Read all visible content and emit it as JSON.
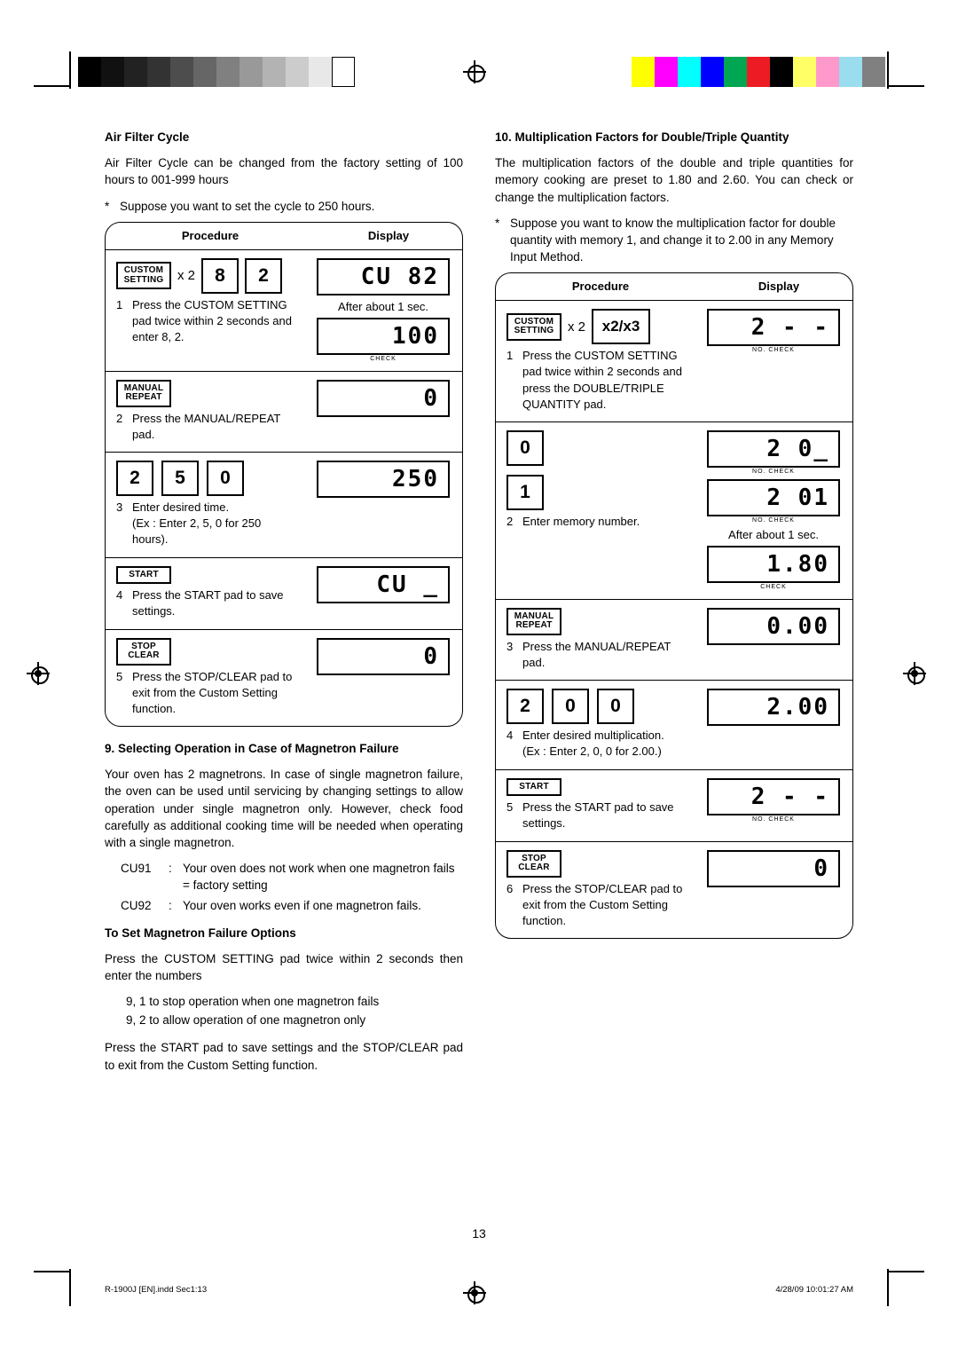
{
  "page": {
    "number": "13",
    "footer_left": "R-1900J [EN].indd   Sec1:13",
    "footer_right": "4/28/09   10:01:27 AM"
  },
  "left_column": {
    "air_filter": {
      "heading": "Air Filter Cycle",
      "intro": "Air Filter Cycle can be changed from the factory setting of 100 hours to 001-999 hours",
      "star": "Suppose you want to set the cycle to 250 hours.",
      "table": {
        "header_procedure": "Procedure",
        "header_display": "Display",
        "rows": [
          {
            "keys": {
              "pad_line1": "CUSTOM",
              "pad_line2": "SETTING",
              "multiplier": "x 2",
              "num1": "8",
              "num2": "2"
            },
            "step_no": "1",
            "step_text": "Press the CUSTOM SETTING pad twice within 2 seconds and enter 8, 2.",
            "display1": "CU 82",
            "display_note": "After about 1 sec.",
            "display2": "100",
            "display2_label": "CHECK"
          },
          {
            "keys": {
              "pad_line1": "MANUAL",
              "pad_line2": "REPEAT"
            },
            "step_no": "2",
            "step_text": "Press the MANUAL/REPEAT pad.",
            "display1": "0"
          },
          {
            "keys": {
              "num1": "2",
              "num2": "5",
              "num3": "0"
            },
            "step_no": "3",
            "step_text": "Enter desired time.",
            "step_sub": "(Ex : Enter 2, 5, 0 for 250 hours).",
            "display1": "250"
          },
          {
            "keys": {
              "pad_line1": "START"
            },
            "step_no": "4",
            "step_text": "Press the START pad to save settings.",
            "display1": "CU _"
          },
          {
            "keys": {
              "pad_line1": "STOP",
              "pad_line2": "CLEAR"
            },
            "step_no": "5",
            "step_text": "Press the STOP/CLEAR pad to exit from the Custom Setting function.",
            "display1": "0"
          }
        ]
      }
    },
    "magnetron": {
      "heading": "9.  Selecting Operation in Case of Magnetron Failure",
      "paragraph": "Your oven has 2 magnetrons. In case of single magnetron failure, the oven can be used until servicing by changing settings to allow operation under single magnetron only. However, check food carefully as additional cooking time will be needed when operating with a single magnetron.",
      "codes": [
        {
          "code": "CU91",
          "sep": ":",
          "text": "Your oven does not work when one magnetron fails =  factory setting"
        },
        {
          "code": "CU92",
          "sep": ":",
          "text": "Your oven works even if one magnetron  fails."
        }
      ],
      "sub_heading": "To Set Magnetron Failure Options",
      "sub_paragraph": "Press the CUSTOM SETTING pad twice within 2 seconds then enter the numbers",
      "options": [
        "9, 1 to stop operation when one magnetron fails",
        "9, 2 to allow operation of one magnetron only"
      ],
      "closing": "Press the START pad to save settings and the STOP/CLEAR pad to exit from the Custom Setting function."
    }
  },
  "right_column": {
    "heading": "10.  Multiplication Factors for Double/Triple Quantity",
    "intro": "The multiplication factors of the double and triple quantities for memory cooking are preset to 1.80 and 2.60. You can check or change the multiplication factors.",
    "star": "Suppose you want to know the multiplication factor for double quantity with memory 1, and change it to 2.00 in any Memory Input Method.",
    "table": {
      "header_procedure": "Procedure",
      "header_display": "Display",
      "rows": [
        {
          "keys": {
            "pad_line1": "CUSTOM",
            "pad_line2": "SETTING",
            "multiplier": "x 2",
            "wide_key": "x2/x3"
          },
          "step_no": "1",
          "step_text": "Press the CUSTOM SETTING pad twice within 2 seconds and press the DOUBLE/TRIPLE QUANTITY pad.",
          "display1": "2   - -",
          "display1_label": "NO.  CHECK"
        },
        {
          "keys": {
            "num_stack": [
              "0",
              "1"
            ]
          },
          "step_no": "2",
          "step_text": "Enter memory number.",
          "display1": "2  0_",
          "display1_label": "NO.  CHECK",
          "display2": "2  01",
          "display2_label": "NO.  CHECK",
          "display_note": "After about 1 sec.",
          "display3": "1.80",
          "display3_label": "CHECK"
        },
        {
          "keys": {
            "pad_line1": "MANUAL",
            "pad_line2": "REPEAT"
          },
          "step_no": "3",
          "step_text": "Press the MANUAL/REPEAT pad.",
          "display1": "0.00"
        },
        {
          "keys": {
            "num1": "2",
            "num2": "0",
            "num3": "0"
          },
          "step_no": "4",
          "step_text": "Enter desired multiplication.",
          "step_sub": "(Ex : Enter 2, 0, 0 for 2.00.)",
          "display1": "2.00"
        },
        {
          "keys": {
            "pad_line1": "START"
          },
          "step_no": "5",
          "step_text": "Press the START pad to save settings.",
          "display1": "2   - -",
          "display1_label": "NO.  CHECK"
        },
        {
          "keys": {
            "pad_line1": "STOP",
            "pad_line2": "CLEAR"
          },
          "step_no": "6",
          "step_text": "Press the STOP/CLEAR pad to exit from the Custom Setting function.",
          "display1": "0"
        }
      ]
    }
  },
  "registration": {
    "grayscale_bar": [
      "#000000",
      "#0d0d0d",
      "#1a1a1a",
      "#333333",
      "#4d4d4d",
      "#666666",
      "#808080",
      "#999999",
      "#b3b3b3",
      "#cccccc",
      "#e6e6e6",
      "#ffffff"
    ],
    "color_bar": [
      "#ffff00",
      "#ff00ff",
      "#00ffff",
      "#0000ff",
      "#00a651",
      "#ed1c24",
      "#000000",
      "#ffff66",
      "#ff99cc",
      "#99ddee",
      "#808080"
    ]
  }
}
